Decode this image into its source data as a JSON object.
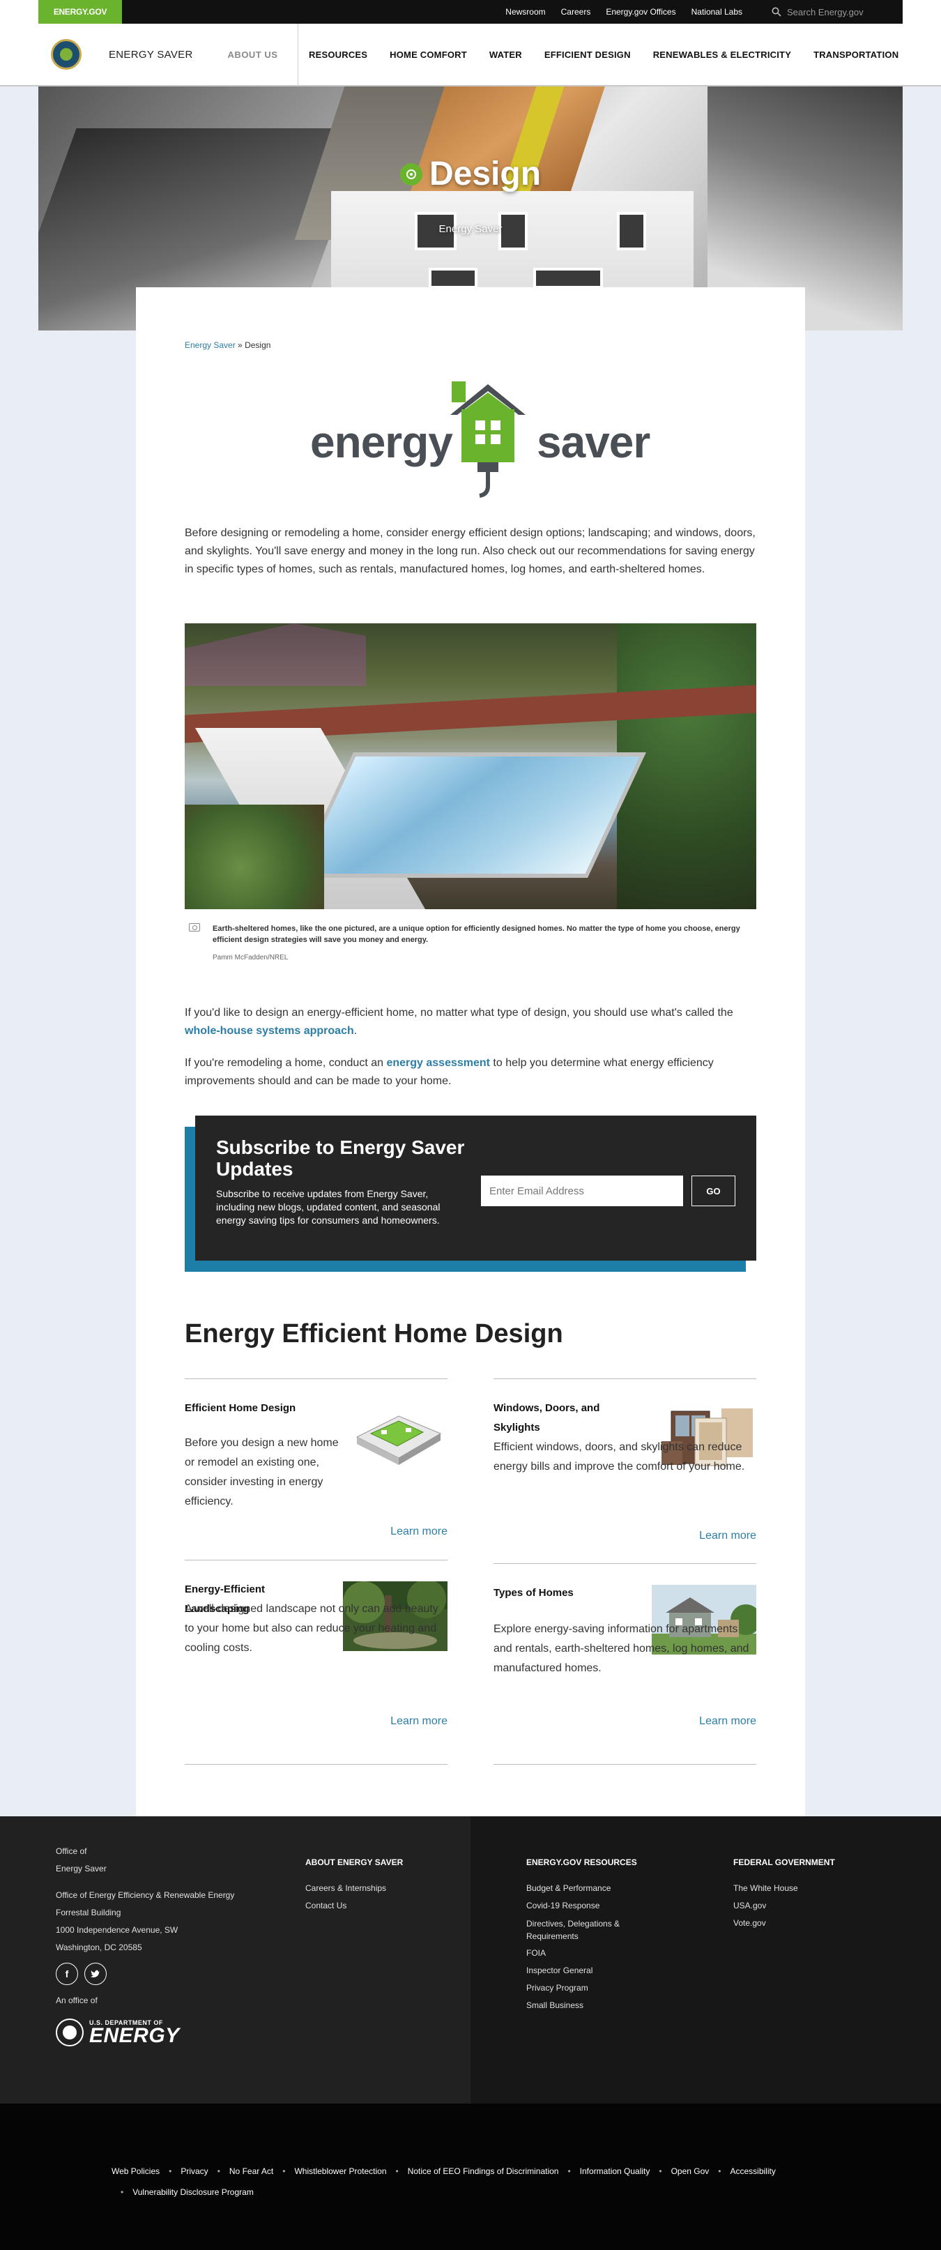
{
  "topbar": {
    "brand": "ENERGY.GOV",
    "links": [
      "Newsroom",
      "Careers",
      "Energy.gov Offices",
      "National Labs"
    ],
    "search_placeholder": "Search Energy.gov"
  },
  "header": {
    "site_name": "ENERGY SAVER",
    "about": "ABOUT US",
    "nav": [
      "RESOURCES",
      "HOME COMFORT",
      "WATER",
      "EFFICIENT DESIGN",
      "RENEWABLES & ELECTRICITY",
      "TRANSPORTATION"
    ]
  },
  "hero": {
    "title": "Design",
    "subtitle": "Energy Saver"
  },
  "breadcrumb": {
    "home": "Energy Saver",
    "separator": "»",
    "current": "Design"
  },
  "logo": {
    "left_word": "energy",
    "right_word": "saver"
  },
  "intro": "Before designing or remodeling a home, consider energy efficient design options; landscaping; and windows, doors, and skylights. You'll save energy and money in the long run. Also check out our recommendations for saving energy in specific types of homes, such as rentals, manufactured homes, log homes, and earth-sheltered homes.",
  "photo": {
    "caption": "Earth-sheltered homes, like the one pictured, are a unique option for efficiently designed homes. No matter the type of home you choose, energy efficient design strategies will save you money and energy.",
    "credit": "Pamm McFadden/NREL"
  },
  "para2": {
    "before": "If you'd like to design an energy-efficient home, no matter what type of design, you should use what's called the ",
    "link": "whole-house systems approach",
    "after": "."
  },
  "para3": {
    "before": "If you're remodeling a home, conduct an ",
    "link": "energy assessment",
    "after": " to help you determine what energy efficiency improvements should and can be made to your home."
  },
  "subscribe": {
    "title": "Subscribe to Energy Saver Updates",
    "description": "Subscribe to receive updates from Energy Saver, including new blogs, updated content, and seasonal energy saving tips for consumers and homeowners.",
    "email_placeholder": "Enter Email Address",
    "button": "GO"
  },
  "section_heading": "Energy Efficient Home Design",
  "cards": [
    {
      "title": "Efficient Home Design",
      "text": "Before you design a new home or remodel an existing one, consider investing in energy efficiency.",
      "link": "Learn more"
    },
    {
      "title": "Windows, Doors, and Skylights",
      "text": "Efficient windows, doors, and skylights can reduce energy bills and improve the comfort of your home.",
      "link": "Learn more"
    },
    {
      "title": "Energy-Efficient Landscaping",
      "text": "A well-designed landscape not only can add beauty to your home but also can reduce your heating and cooling costs.",
      "link": "Learn more"
    },
    {
      "title": "Types of Homes",
      "text": "Explore energy-saving information for apartments and rentals, earth-sheltered homes, log homes, and manufactured homes.",
      "link": "Learn more"
    }
  ],
  "footer": {
    "office_of": "Office of",
    "office_name": "Energy Saver",
    "address": [
      "Office of Energy Efficiency & Renewable Energy",
      "Forrestal Building",
      "1000 Independence Avenue, SW",
      "Washington, DC 20585"
    ],
    "an_office_of": "An office of",
    "doe_small": "U.S. DEPARTMENT OF",
    "doe_big": "ENERGY",
    "about_heading": "ABOUT ENERGY SAVER",
    "about_links": [
      "Careers & Internships",
      "Contact Us"
    ],
    "resources_heading": "ENERGY.GOV RESOURCES",
    "resources_links": [
      "Budget & Performance",
      "Covid-19 Response",
      "Directives, Delegations & Requirements",
      "FOIA",
      "Inspector General",
      "Privacy Program",
      "Small Business"
    ],
    "federal_heading": "FEDERAL GOVERNMENT",
    "federal_links": [
      "The White House",
      "USA.gov",
      "Vote.gov"
    ]
  },
  "bottom_links": [
    "Web Policies",
    "Privacy",
    "No Fear Act",
    "Whistleblower Protection",
    "Notice of EEO Findings of Discrimination",
    "Information Quality",
    "Open Gov",
    "Accessibility",
    "Vulnerability Disclosure Program"
  ],
  "colors": {
    "brand_green": "#6ab42d",
    "link_blue": "#2d7ea6",
    "subscribe_accent": "#1d7fa8",
    "dark": "#212121"
  }
}
